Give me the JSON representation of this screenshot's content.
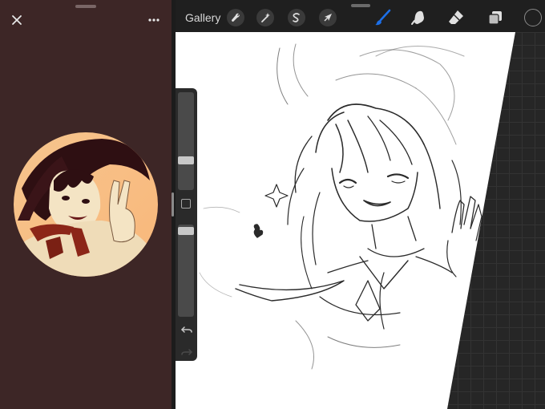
{
  "toolbar": {
    "gallery_label": "Gallery",
    "tools": [
      "wrench-icon",
      "magic-wand-icon",
      "selection-icon",
      "transform-arrow-icon",
      "brush-icon",
      "smudge-icon",
      "eraser-icon",
      "layers-icon"
    ],
    "active_tool": "brush-icon",
    "active_color": "#1c6fe8",
    "current_color": "#202020"
  },
  "reference": {
    "close_icon": "close-icon",
    "more_icon": "more-icon",
    "panel_color": "#3d2626"
  },
  "sidebar": {
    "brush_size_level": 0.26,
    "opacity_level": 0.05,
    "icons": [
      "modify-square-icon",
      "undo-icon",
      "redo-icon"
    ]
  }
}
